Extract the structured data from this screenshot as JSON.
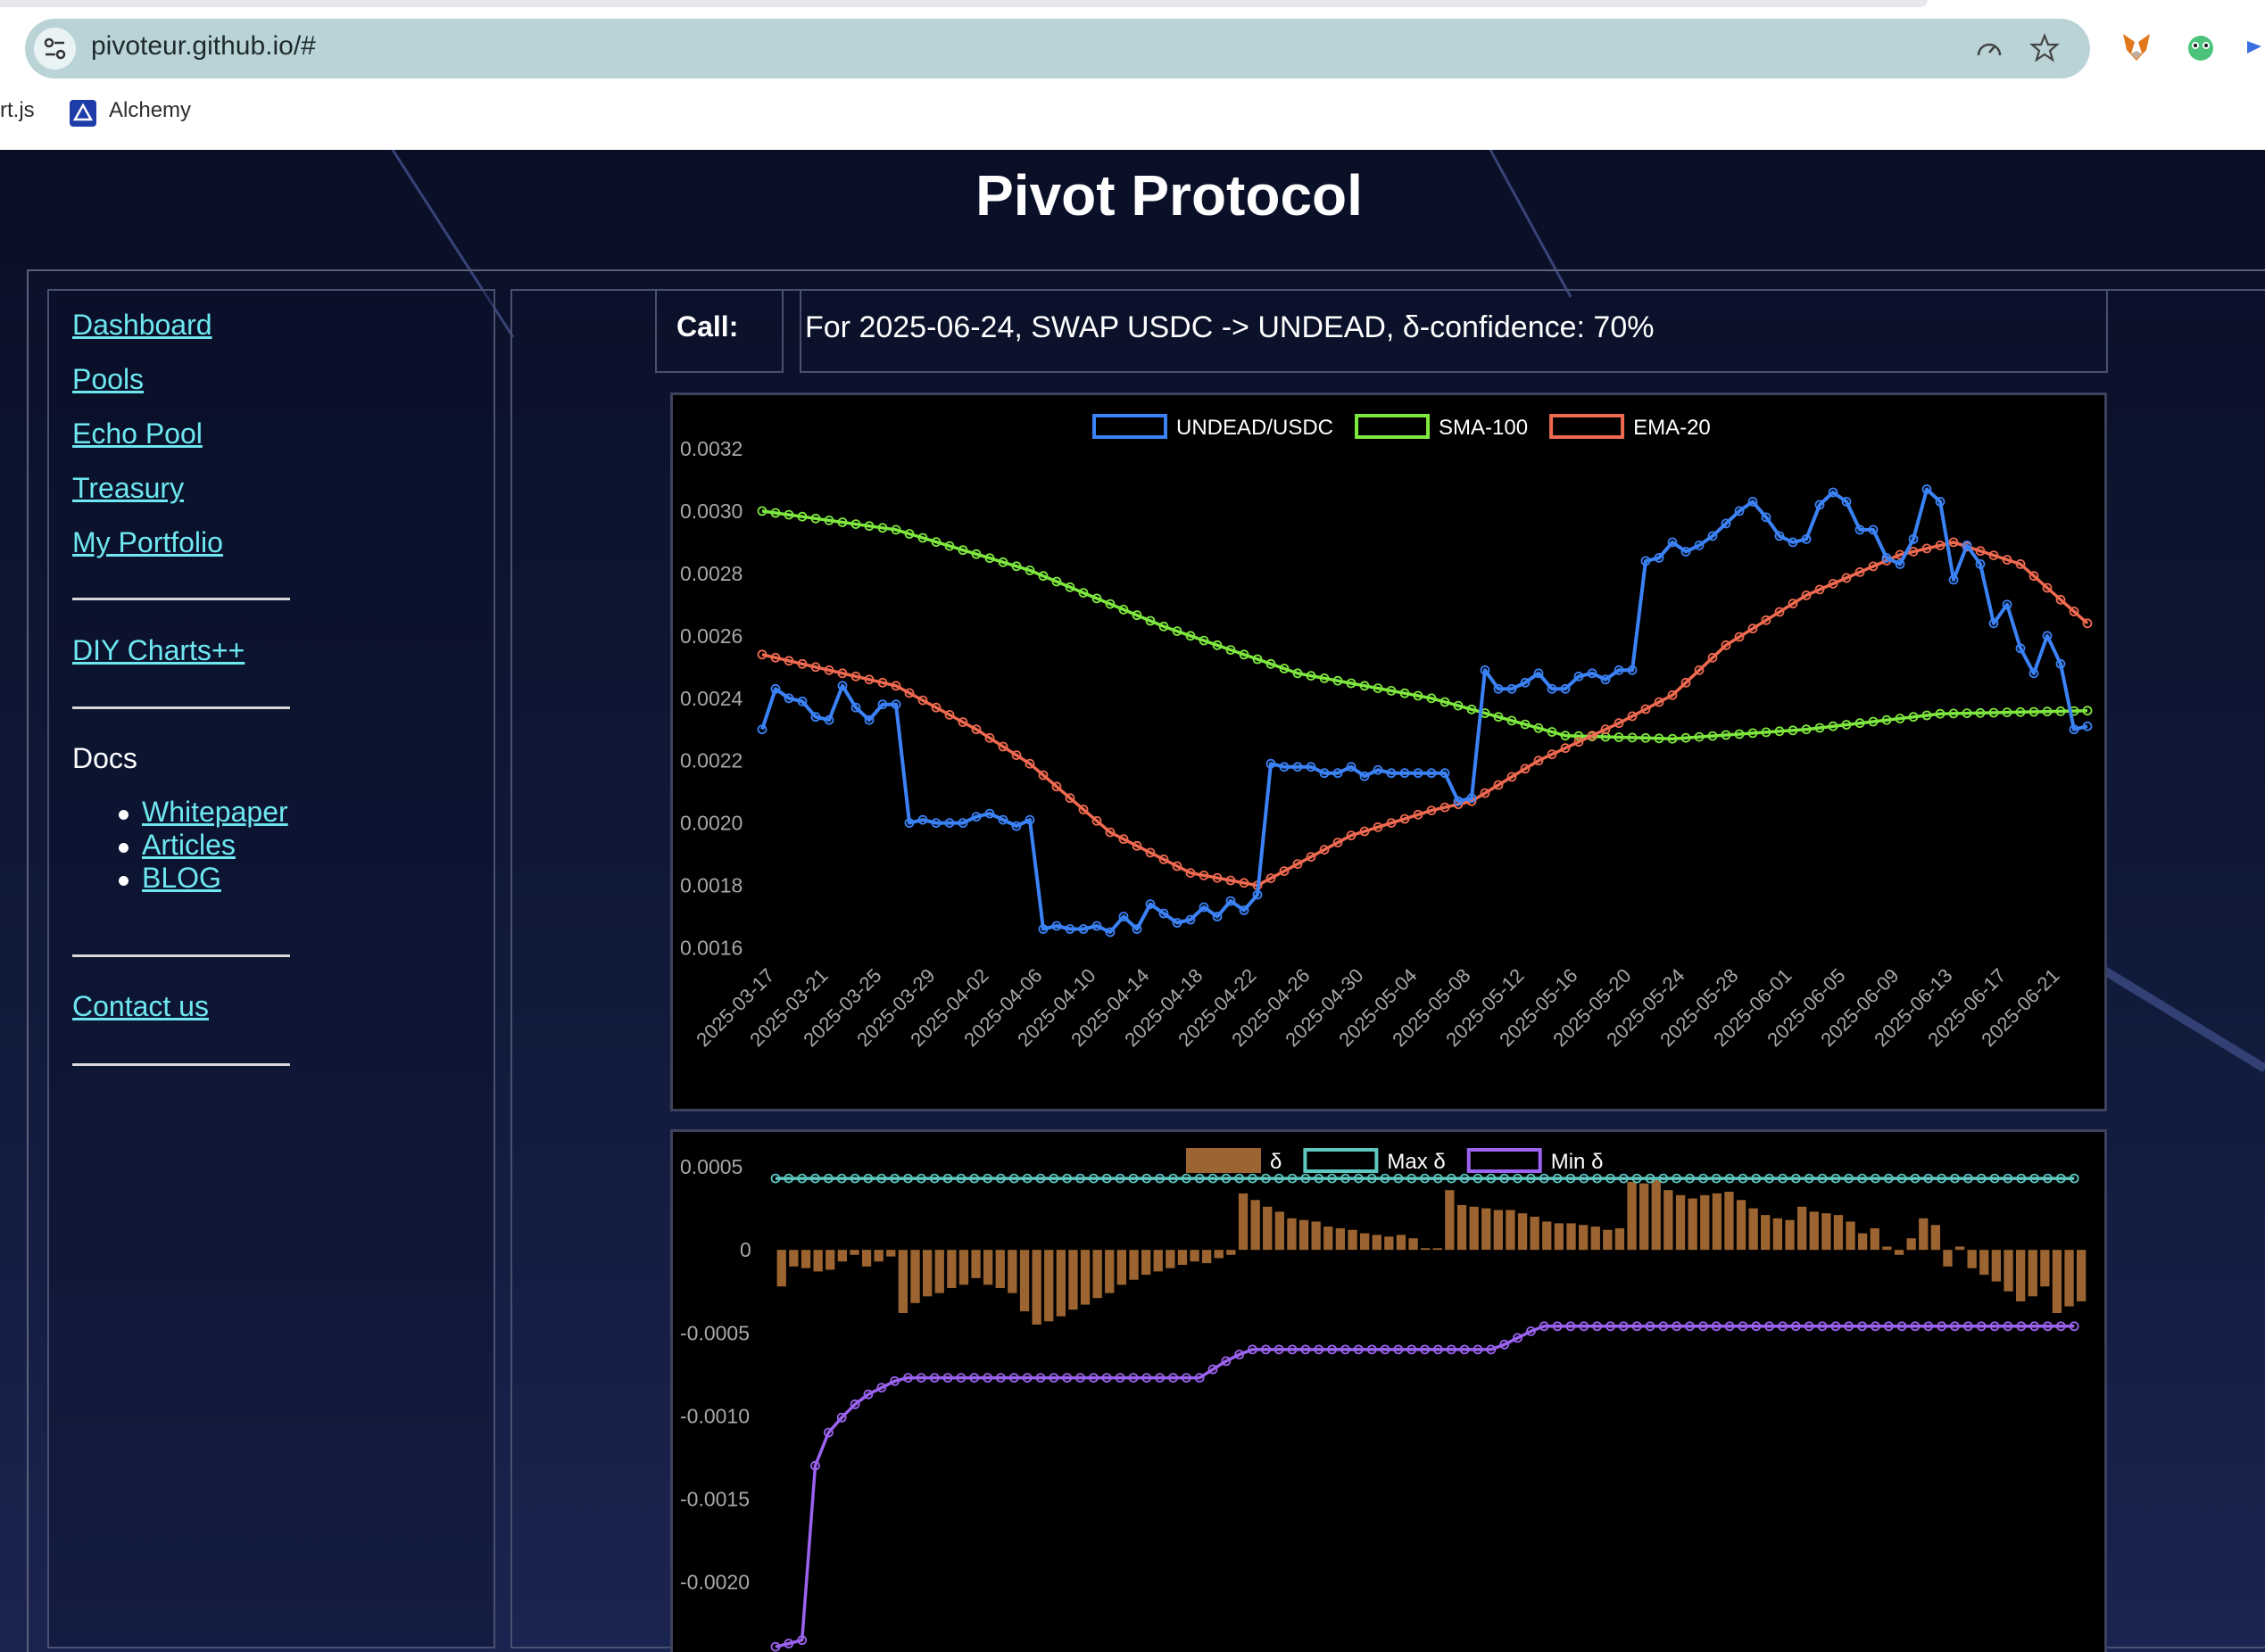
{
  "browser": {
    "url": "pivoteur.github.io/#",
    "bookmarks": [
      "rt.js",
      "Alchemy"
    ]
  },
  "page": {
    "title": "Pivot Protocol"
  },
  "sidebar": {
    "items": [
      {
        "label": "Dashboard"
      },
      {
        "label": "Pools"
      },
      {
        "label": "Echo Pool"
      },
      {
        "label": "Treasury"
      },
      {
        "label": "My Portfolio"
      }
    ],
    "diy_label": "DIY Charts++",
    "docs_heading": "Docs",
    "docs_items": [
      {
        "label": "Whitepaper"
      },
      {
        "label": "Articles"
      },
      {
        "label": "BLOG"
      }
    ],
    "contact_label": "Contact us"
  },
  "call": {
    "label": "Call:",
    "text": "For 2025-06-24, SWAP USDC -> UNDEAD, δ-confidence: 70%"
  },
  "colors": {
    "price": "#3b82f6",
    "sma": "#7ee83f",
    "ema": "#ef6a50",
    "delta": "#9c6430",
    "max_delta": "#5ec7c0",
    "min_delta": "#9b63f0",
    "link": "#6ee7f0"
  },
  "chart_data": [
    {
      "type": "line",
      "legend": [
        "UNDEAD/USDC",
        "SMA-100",
        "EMA-20"
      ],
      "x_tick_labels": [
        "2025-03-17",
        "2025-03-21",
        "2025-03-25",
        "2025-03-29",
        "2025-04-02",
        "2025-04-06",
        "2025-04-10",
        "2025-04-14",
        "2025-04-18",
        "2025-04-22",
        "2025-04-26",
        "2025-04-30",
        "2025-05-04",
        "2025-05-08",
        "2025-05-12",
        "2025-05-16",
        "2025-05-20",
        "2025-05-24",
        "2025-05-28",
        "2025-06-01",
        "2025-06-05",
        "2025-06-09",
        "2025-06-13",
        "2025-06-17",
        "2025-06-21"
      ],
      "y_tick_labels": [
        "0.0032",
        "0.0030",
        "0.0028",
        "0.0026",
        "0.0024",
        "0.0022",
        "0.0020",
        "0.0018",
        "0.0016"
      ],
      "ylim": [
        0.00157,
        0.0032
      ],
      "x_range": [
        "2025-03-17",
        "2025-06-24"
      ],
      "series": [
        {
          "name": "UNDEAD/USDC",
          "points": [
            [
              "2025-03-17",
              0.0023
            ],
            [
              "2025-03-18",
              0.00243
            ],
            [
              "2025-03-19",
              0.0024
            ],
            [
              "2025-03-20",
              0.00239
            ],
            [
              "2025-03-21",
              0.00234
            ],
            [
              "2025-03-22",
              0.00233
            ],
            [
              "2025-03-23",
              0.00244
            ],
            [
              "2025-03-24",
              0.00237
            ],
            [
              "2025-03-25",
              0.00233
            ],
            [
              "2025-03-26",
              0.00238
            ],
            [
              "2025-03-27",
              0.00238
            ],
            [
              "2025-03-28",
              0.002
            ],
            [
              "2025-03-29",
              0.00201
            ],
            [
              "2025-03-30",
              0.002
            ],
            [
              "2025-03-31",
              0.002
            ],
            [
              "2025-04-01",
              0.002
            ],
            [
              "2025-04-02",
              0.00202
            ],
            [
              "2025-04-03",
              0.00203
            ],
            [
              "2025-04-04",
              0.00201
            ],
            [
              "2025-04-05",
              0.00199
            ],
            [
              "2025-04-06",
              0.00201
            ],
            [
              "2025-04-07",
              0.00166
            ],
            [
              "2025-04-08",
              0.00167
            ],
            [
              "2025-04-09",
              0.00166
            ],
            [
              "2025-04-10",
              0.00166
            ],
            [
              "2025-04-11",
              0.00167
            ],
            [
              "2025-04-12",
              0.00165
            ],
            [
              "2025-04-13",
              0.0017
            ],
            [
              "2025-04-14",
              0.00166
            ],
            [
              "2025-04-15",
              0.00174
            ],
            [
              "2025-04-16",
              0.00171
            ],
            [
              "2025-04-17",
              0.00168
            ],
            [
              "2025-04-18",
              0.00169
            ],
            [
              "2025-04-19",
              0.00173
            ],
            [
              "2025-04-20",
              0.0017
            ],
            [
              "2025-04-21",
              0.00175
            ],
            [
              "2025-04-22",
              0.00172
            ],
            [
              "2025-04-23",
              0.00177
            ],
            [
              "2025-04-24",
              0.00219
            ],
            [
              "2025-04-25",
              0.00218
            ],
            [
              "2025-04-26",
              0.00218
            ],
            [
              "2025-04-27",
              0.00218
            ],
            [
              "2025-04-28",
              0.00216
            ],
            [
              "2025-04-29",
              0.00216
            ],
            [
              "2025-04-30",
              0.00218
            ],
            [
              "2025-05-01",
              0.00215
            ],
            [
              "2025-05-02",
              0.00217
            ],
            [
              "2025-05-03",
              0.00216
            ],
            [
              "2025-05-04",
              0.00216
            ],
            [
              "2025-05-05",
              0.00216
            ],
            [
              "2025-05-06",
              0.00216
            ],
            [
              "2025-05-07",
              0.00216
            ],
            [
              "2025-05-08",
              0.00207
            ],
            [
              "2025-05-09",
              0.00208
            ],
            [
              "2025-05-10",
              0.00249
            ],
            [
              "2025-05-11",
              0.00243
            ],
            [
              "2025-05-12",
              0.00243
            ],
            [
              "2025-05-13",
              0.00245
            ],
            [
              "2025-05-14",
              0.00248
            ],
            [
              "2025-05-15",
              0.00243
            ],
            [
              "2025-05-16",
              0.00243
            ],
            [
              "2025-05-17",
              0.00247
            ],
            [
              "2025-05-18",
              0.00248
            ],
            [
              "2025-05-19",
              0.00246
            ],
            [
              "2025-05-20",
              0.00249
            ],
            [
              "2025-05-21",
              0.00249
            ],
            [
              "2025-05-22",
              0.00284
            ],
            [
              "2025-05-23",
              0.00285
            ],
            [
              "2025-05-24",
              0.0029
            ],
            [
              "2025-05-25",
              0.00287
            ],
            [
              "2025-05-26",
              0.00289
            ],
            [
              "2025-05-27",
              0.00292
            ],
            [
              "2025-05-28",
              0.00296
            ],
            [
              "2025-05-29",
              0.003
            ],
            [
              "2025-05-30",
              0.00303
            ],
            [
              "2025-05-31",
              0.00298
            ],
            [
              "2025-06-01",
              0.00292
            ],
            [
              "2025-06-02",
              0.0029
            ],
            [
              "2025-06-03",
              0.00291
            ],
            [
              "2025-06-04",
              0.00302
            ],
            [
              "2025-06-05",
              0.00306
            ],
            [
              "2025-06-06",
              0.00303
            ],
            [
              "2025-06-07",
              0.00294
            ],
            [
              "2025-06-08",
              0.00294
            ],
            [
              "2025-06-09",
              0.00285
            ],
            [
              "2025-06-10",
              0.00283
            ],
            [
              "2025-06-11",
              0.00291
            ],
            [
              "2025-06-12",
              0.00307
            ],
            [
              "2025-06-13",
              0.00303
            ],
            [
              "2025-06-14",
              0.00278
            ],
            [
              "2025-06-15",
              0.00289
            ],
            [
              "2025-06-16",
              0.00283
            ],
            [
              "2025-06-17",
              0.00264
            ],
            [
              "2025-06-18",
              0.0027
            ],
            [
              "2025-06-19",
              0.00256
            ],
            [
              "2025-06-20",
              0.00248
            ],
            [
              "2025-06-21",
              0.0026
            ],
            [
              "2025-06-22",
              0.00251
            ],
            [
              "2025-06-23",
              0.0023
            ],
            [
              "2025-06-24",
              0.00231
            ]
          ]
        },
        {
          "name": "SMA-100",
          "points": [
            [
              "2025-03-17",
              0.003
            ],
            [
              "2025-03-27",
              0.00294
            ],
            [
              "2025-04-06",
              0.00281
            ],
            [
              "2025-04-16",
              0.00263
            ],
            [
              "2025-04-26",
              0.00248
            ],
            [
              "2025-05-06",
              0.0024
            ],
            [
              "2025-05-16",
              0.00228
            ],
            [
              "2025-05-24",
              0.00227
            ],
            [
              "2025-06-03",
              0.0023
            ],
            [
              "2025-06-13",
              0.00235
            ],
            [
              "2025-06-24",
              0.00236
            ]
          ]
        },
        {
          "name": "EMA-20",
          "points": [
            [
              "2025-03-17",
              0.00254
            ],
            [
              "2025-03-21",
              0.0025
            ],
            [
              "2025-03-27",
              0.00244
            ],
            [
              "2025-04-02",
              0.0023
            ],
            [
              "2025-04-06",
              0.00219
            ],
            [
              "2025-04-12",
              0.00197
            ],
            [
              "2025-04-18",
              0.00184
            ],
            [
              "2025-04-23",
              0.0018
            ],
            [
              "2025-04-30",
              0.00196
            ],
            [
              "2025-05-06",
              0.00204
            ],
            [
              "2025-05-09",
              0.00207
            ],
            [
              "2025-05-14",
              0.0022
            ],
            [
              "2025-05-20",
              0.00232
            ],
            [
              "2025-05-24",
              0.00241
            ],
            [
              "2025-05-28",
              0.00257
            ],
            [
              "2025-06-03",
              0.00273
            ],
            [
              "2025-06-10",
              0.00286
            ],
            [
              "2025-06-14",
              0.0029
            ],
            [
              "2025-06-19",
              0.00283
            ],
            [
              "2025-06-24",
              0.00264
            ]
          ]
        }
      ]
    },
    {
      "type": "bar",
      "legend": [
        "δ",
        "Max δ",
        "Min δ"
      ],
      "y_tick_labels": [
        "0.0005",
        "0",
        "-0.0005",
        "-0.0010",
        "-0.0015",
        "-0.0020"
      ],
      "x_range": [
        "2025-03-17",
        "2025-06-24"
      ],
      "series": [
        {
          "name": "δ",
          "values": [
            -0.00022,
            -0.0001,
            -0.00011,
            -0.00013,
            -0.00012,
            -7e-05,
            -3e-05,
            -0.0001,
            -7e-05,
            -4e-05,
            -0.00038,
            -0.00032,
            -0.00028,
            -0.00026,
            -0.00023,
            -0.00021,
            -0.00017,
            -0.00021,
            -0.00023,
            -0.00026,
            -0.00037,
            -0.00045,
            -0.00043,
            -0.0004,
            -0.00036,
            -0.00033,
            -0.00029,
            -0.00026,
            -0.00021,
            -0.00018,
            -0.00015,
            -0.00013,
            -0.00011,
            -9e-05,
            -7e-05,
            -8e-05,
            -5e-05,
            -3e-05,
            0.00034,
            0.0003,
            0.00026,
            0.00023,
            0.00019,
            0.00018,
            0.00017,
            0.00014,
            0.00013,
            0.00012,
            0.0001,
            9e-05,
            8e-05,
            9e-05,
            7e-05,
            1e-05,
            1e-05,
            0.00036,
            0.00027,
            0.00026,
            0.00025,
            0.00024,
            0.00024,
            0.00022,
            0.0002,
            0.00017,
            0.00016,
            0.00016,
            0.00015,
            0.00014,
            0.00012,
            0.00013,
            0.00041,
            0.0004,
            0.00042,
            0.00036,
            0.00033,
            0.00031,
            0.00033,
            0.00034,
            0.00035,
            0.0003,
            0.00025,
            0.00021,
            0.00019,
            0.00018,
            0.00026,
            0.00023,
            0.00022,
            0.00021,
            0.00017,
            0.0001,
            0.00013,
            2e-05,
            -3e-05,
            7e-05,
            0.00019,
            0.00015,
            -0.0001,
            2e-05,
            -0.00011,
            -0.00015,
            -0.00019,
            -0.00025,
            -0.00031,
            -0.00028,
            -0.00022,
            -0.00038,
            -0.00034,
            -0.00031
          ]
        },
        {
          "name": "Max δ",
          "constant": 0.00043
        },
        {
          "name": "Min δ",
          "points": [
            [
              "2025-03-17",
              -0.00239
            ],
            [
              "2025-03-18",
              -0.00237
            ],
            [
              "2025-03-19",
              -0.00235
            ],
            [
              "2025-03-20",
              -0.0013
            ],
            [
              "2025-03-21",
              -0.0011
            ],
            [
              "2025-03-22",
              -0.00101
            ],
            [
              "2025-03-23",
              -0.00093
            ],
            [
              "2025-03-24",
              -0.00087
            ],
            [
              "2025-03-25",
              -0.00083
            ],
            [
              "2025-03-26",
              -0.00079
            ],
            [
              "2025-03-27",
              -0.00077
            ],
            [
              "2025-04-18",
              -0.00077
            ],
            [
              "2025-04-19",
              -0.00072
            ],
            [
              "2025-04-20",
              -0.00067
            ],
            [
              "2025-04-21",
              -0.00063
            ],
            [
              "2025-04-22",
              -0.0006
            ],
            [
              "2025-05-10",
              -0.0006
            ],
            [
              "2025-05-11",
              -0.00057
            ],
            [
              "2025-05-12",
              -0.00053
            ],
            [
              "2025-05-13",
              -0.00049
            ],
            [
              "2025-05-14",
              -0.00046
            ],
            [
              "2025-06-23",
              -0.00046
            ]
          ]
        }
      ]
    }
  ]
}
